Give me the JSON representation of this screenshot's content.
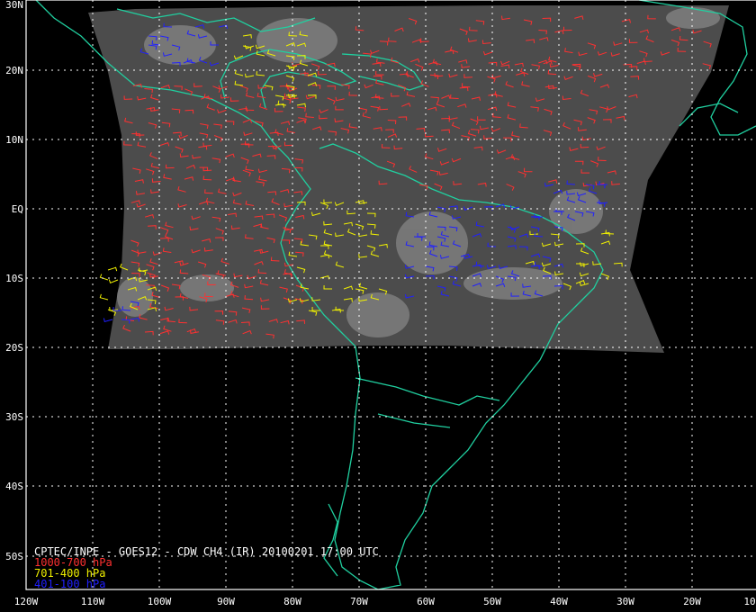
{
  "map": {
    "lat_labels": [
      "30N",
      "20N",
      "10N",
      "EQ",
      "10S",
      "20S",
      "30S",
      "40S",
      "50S"
    ],
    "lon_labels": [
      "120W",
      "110W",
      "100W",
      "90W",
      "80W",
      "70W",
      "60W",
      "50W",
      "40W",
      "30W",
      "20W",
      "10"
    ],
    "caption": "CPTEC/INPE - GOES12 - CDW CH4 (IR) 20100201 17:00 UTC",
    "legend": [
      {
        "label": "1000-700 hPa",
        "color": "#ff3030"
      },
      {
        "label": "701-400 hPa",
        "color": "#f0f000"
      },
      {
        "label": "401-100 hPa",
        "color": "#2020ff"
      }
    ],
    "colors": {
      "grid": "#ffffff",
      "coast": "#20d0a0",
      "background": "#000000",
      "image": "#5a5a5a"
    }
  }
}
